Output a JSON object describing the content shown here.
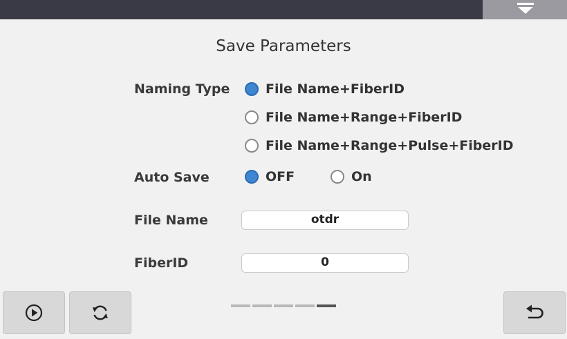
{
  "page": {
    "title": "Save Parameters"
  },
  "naming_type": {
    "label": "Naming Type",
    "options": [
      {
        "label": "File Name+FiberID",
        "selected": true
      },
      {
        "label": "File Name+Range+FiberID",
        "selected": false
      },
      {
        "label": "File Name+Range+Pulse+FiberID",
        "selected": false
      }
    ]
  },
  "auto_save": {
    "label": "Auto Save",
    "options": [
      {
        "label": "OFF",
        "selected": true
      },
      {
        "label": "On",
        "selected": false
      }
    ]
  },
  "file_name": {
    "label": "File Name",
    "value": "otdr"
  },
  "fiber_id": {
    "label": "FiberID",
    "value": "0"
  },
  "toolbar": {
    "play_icon": "play-circle-icon",
    "refresh_icon": "refresh-icon",
    "back_icon": "return-arrow-icon",
    "dropdown_icon": "chevron-down-icon"
  },
  "pager": {
    "pages": 5,
    "current": 5
  },
  "colors": {
    "accent": "#3f86d1",
    "topbar": "#3a3a46",
    "background": "#f1f1f1"
  }
}
